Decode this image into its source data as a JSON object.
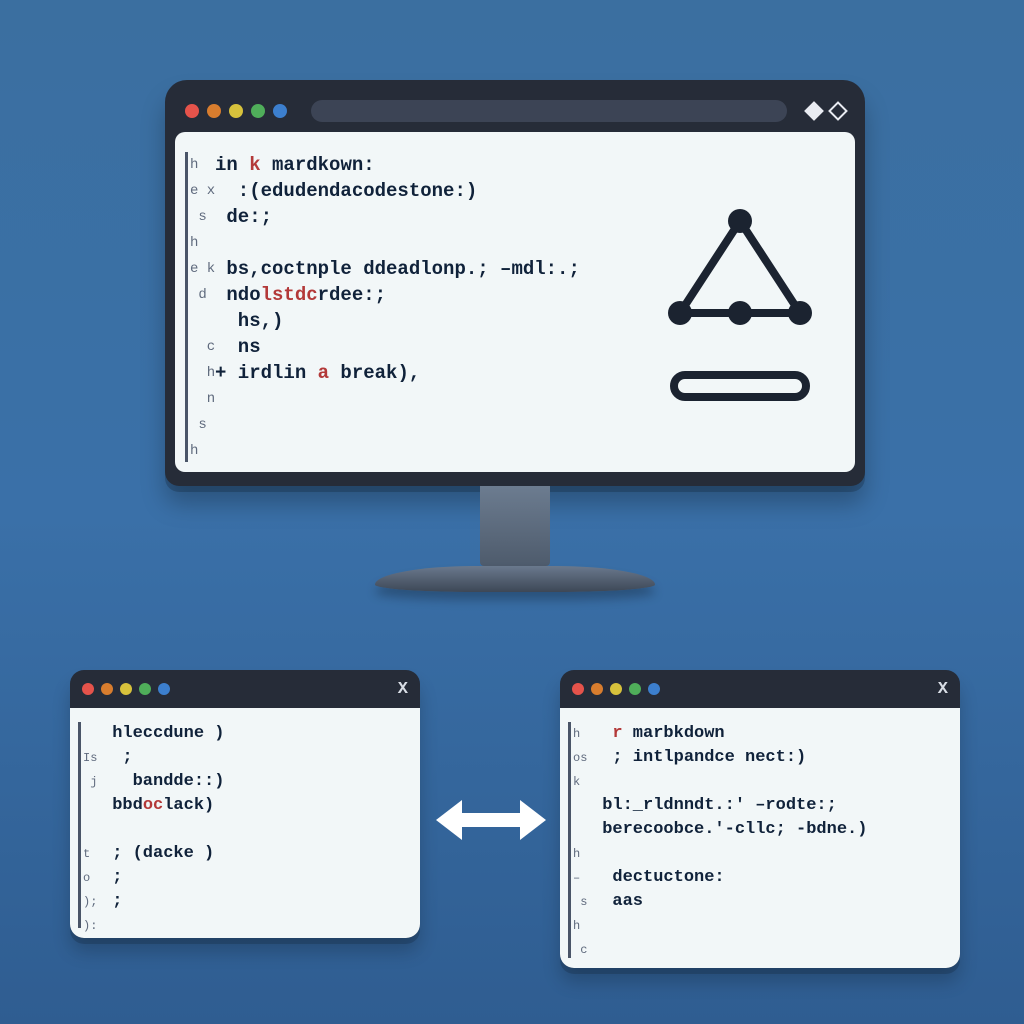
{
  "monitor": {
    "gutter": "h\ne x\n s\nh\ne k\n d\n\n  c\n  h\n  n\n s\nh",
    "code_plain_0": "in ",
    "code_kw_0": "k",
    "code_plain_1": " mardkown:\n  :(edudendacodestone:)\n de:;\n\n bs,coctnple ddeadlonp.; –mdl:.;\n ndo",
    "code_kw_1": "lstdc",
    "code_plain_2": "rdee:;\n  hs,)\n  ns\n+ irdlin ",
    "code_kw_2": "a",
    "code_plain_3": " break),"
  },
  "left_window": {
    "gutter": "\nIs\n j\n\n\nt\no\n);\n):",
    "code_plain_0": " hleccdune )\n  ; \n   bandde::)\n bbd",
    "code_kw_0": "oc",
    "code_plain_1": "lack)\n\n ; (dacke )\n ;\n ;"
  },
  "right_window": {
    "gutter": "h\nos\nk\n\n\nh\n–\n s\nh\n c\nh",
    "code_plain_0": "  ",
    "code_kw_0": "r",
    "code_plain_1": " marbkdown\n  ; intlpandce nect:)\n\n bl:_rldnndt.:' –rodte:;\n berecoobce.'-cllc; -bdne.)\n\n  dectuctone:\n  aas\n"
  }
}
